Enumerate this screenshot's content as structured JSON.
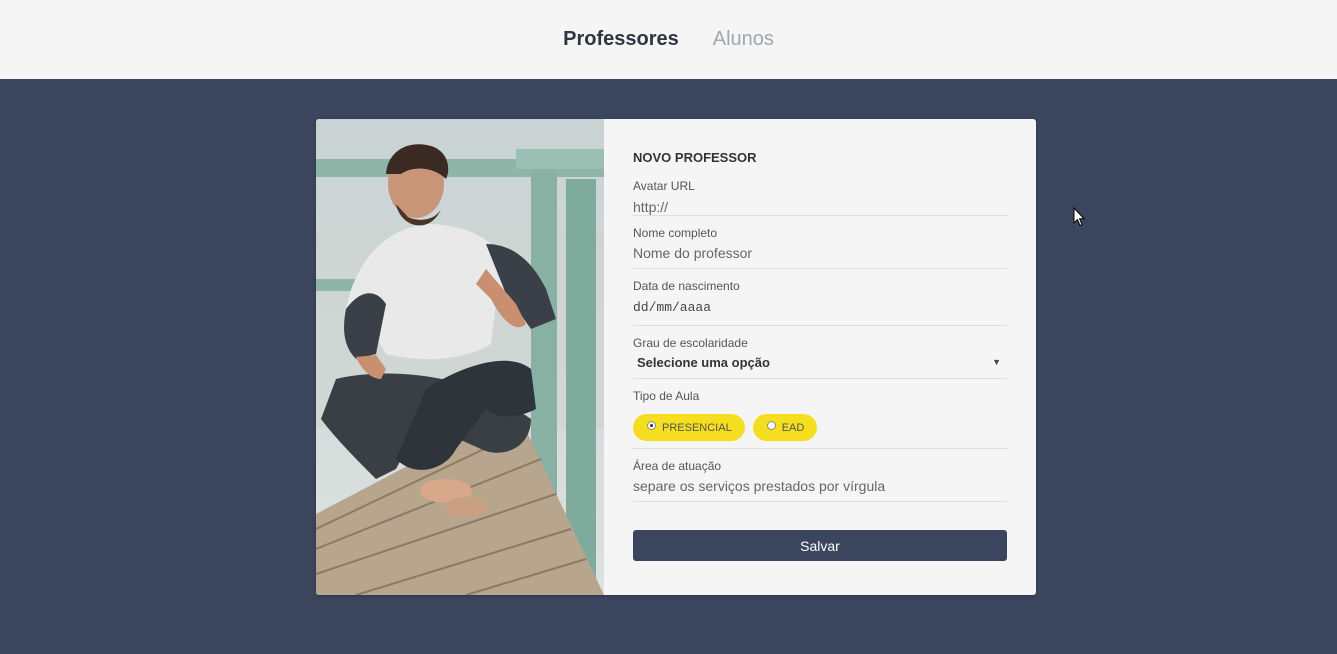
{
  "nav": {
    "items": [
      {
        "label": "Professores",
        "active": true
      },
      {
        "label": "Alunos",
        "active": false
      }
    ]
  },
  "form": {
    "title": "NOVO PROFESSOR",
    "avatar": {
      "label": "Avatar URL",
      "placeholder": "http://"
    },
    "nome": {
      "label": "Nome completo",
      "placeholder": "Nome do professor"
    },
    "data": {
      "label": "Data de nascimento",
      "placeholder": "dd/mm/aaaa"
    },
    "grau": {
      "label": "Grau de escolaridade",
      "selected": "Selecione uma opção"
    },
    "tipo": {
      "label": "Tipo de Aula",
      "options": [
        {
          "label": "PRESENCIAL",
          "checked": true
        },
        {
          "label": "EAD",
          "checked": false
        }
      ]
    },
    "area": {
      "label": "Área de atuação",
      "placeholder": "separe os serviços prestados por vírgula"
    },
    "save_label": "Salvar"
  },
  "colors": {
    "background": "#3b455e",
    "nav_bg": "#f5f5f5",
    "accent_yellow": "#f5dd1f",
    "button": "#3b455e"
  },
  "icons": {
    "select_caret": "caret-down-icon",
    "cursor": "mouse-pointer-icon"
  }
}
